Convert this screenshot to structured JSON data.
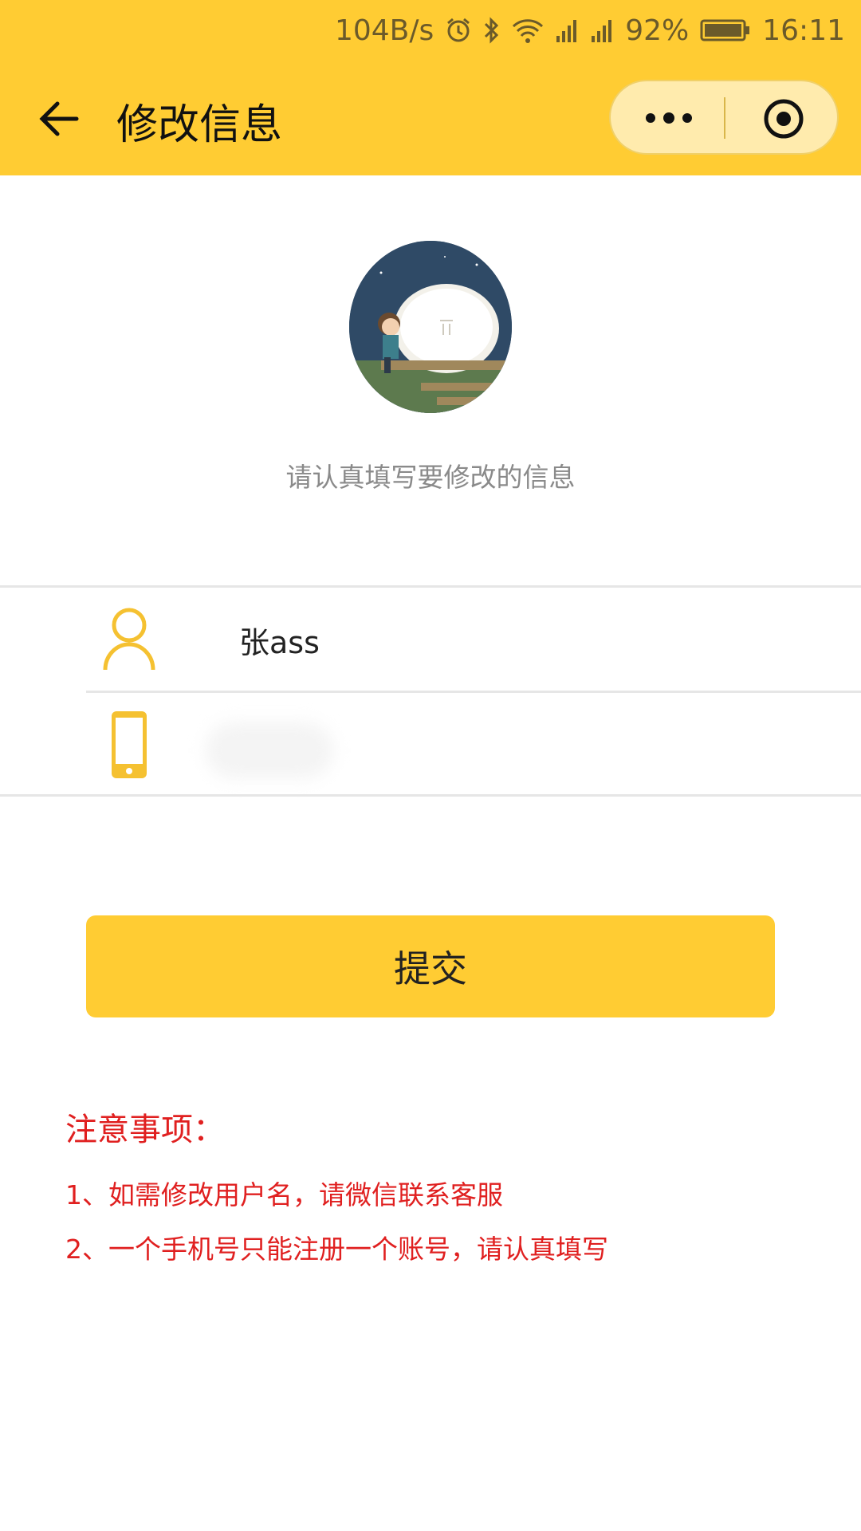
{
  "status_bar": {
    "speed": "104B/s",
    "battery": "92%",
    "time": "16:11"
  },
  "navbar": {
    "title": "修改信息",
    "back_icon": "arrow-left-icon",
    "more_icon": "more-dots-icon",
    "close_icon": "target-circle-icon"
  },
  "profile": {
    "hint": "请认真填写要修改的信息"
  },
  "form": {
    "username_value": "张ass",
    "phone_value": ""
  },
  "submit_label": "提交",
  "notes": {
    "title": "注意事项：",
    "items": [
      "1、如需修改用户名，请微信联系客服",
      "2、一个手机号只能注册一个账号，请认真填写"
    ]
  },
  "colors": {
    "accent": "#ffcc33",
    "warning": "#e02020"
  }
}
